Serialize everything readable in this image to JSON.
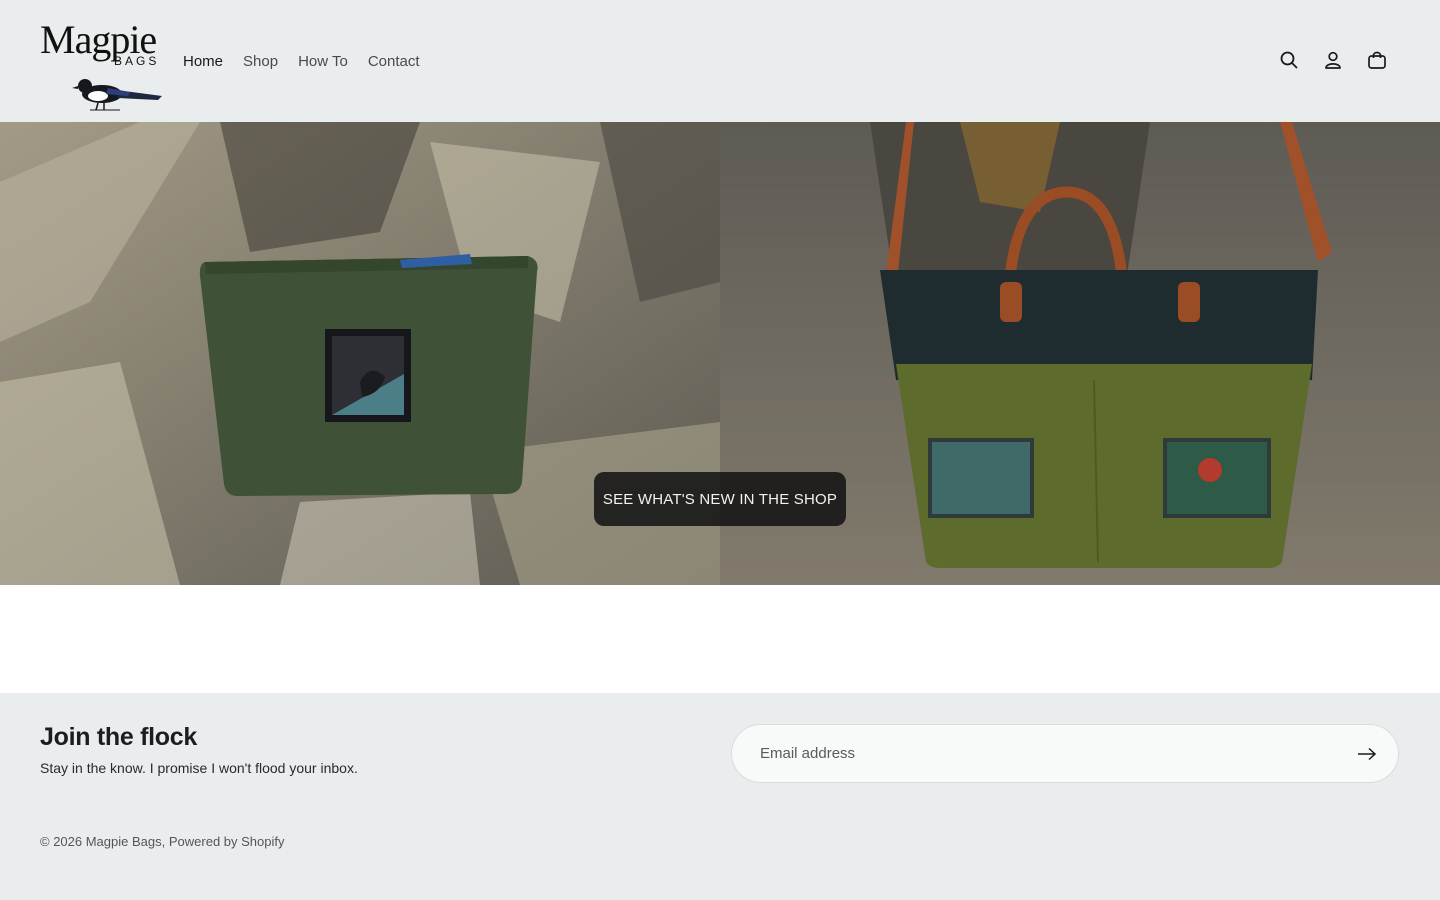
{
  "brand": {
    "name_word": "Magpie",
    "name_sub": "BAGS"
  },
  "nav": {
    "items": [
      {
        "label": "Home",
        "active": true
      },
      {
        "label": "Shop"
      },
      {
        "label": "How To"
      },
      {
        "label": "Contact"
      }
    ]
  },
  "header_icons": [
    "search-icon",
    "account-icon",
    "cart-icon"
  ],
  "hero": {
    "cta_label": "SEE WHAT'S NEW IN THE SHOP"
  },
  "newsletter": {
    "title": "Join the flock",
    "subtitle": "Stay in the know. I promise I won't flood your inbox.",
    "email_placeholder": "Email address"
  },
  "footer": {
    "copyright": "© 2026 Magpie Bags",
    "separator": ",",
    "powered_by": "Powered by Shopify"
  },
  "colors": {
    "page_bg": "#eaedee",
    "cta_bg": "#141414",
    "text": "#1a1a1a"
  }
}
